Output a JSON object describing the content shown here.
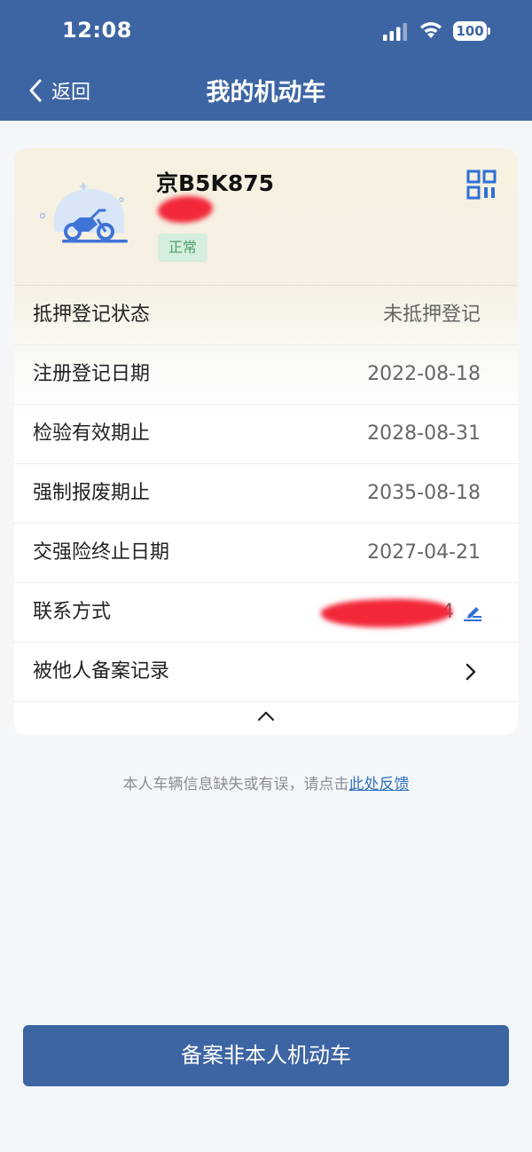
{
  "status_bar": {
    "time": "12:08",
    "battery": "100"
  },
  "nav": {
    "back_label": "返回",
    "title": "我的机动车"
  },
  "vehicle": {
    "plate": "京B5K875",
    "status": "正常"
  },
  "details": [
    {
      "label": "抵押登记状态",
      "value": "未抵押登记"
    },
    {
      "label": "注册登记日期",
      "value": "2022-08-18"
    },
    {
      "label": "检验有效期止",
      "value": "2028-08-31"
    },
    {
      "label": "强制报废期止",
      "value": "2035-08-18"
    },
    {
      "label": "交强险终止日期",
      "value": "2027-04-21"
    },
    {
      "label": "联系方式",
      "value": "4"
    },
    {
      "label": "被他人备案记录",
      "value": ""
    }
  ],
  "feedback": {
    "text": "本人车辆信息缺失或有误，请点击",
    "link": "此处反馈"
  },
  "primary_button": "备案非本人机动车",
  "colors": {
    "brand": "#3d65a3",
    "badge_bg": "#d5eedd",
    "badge_text": "#4f9e68",
    "link": "#2f6fc0"
  }
}
